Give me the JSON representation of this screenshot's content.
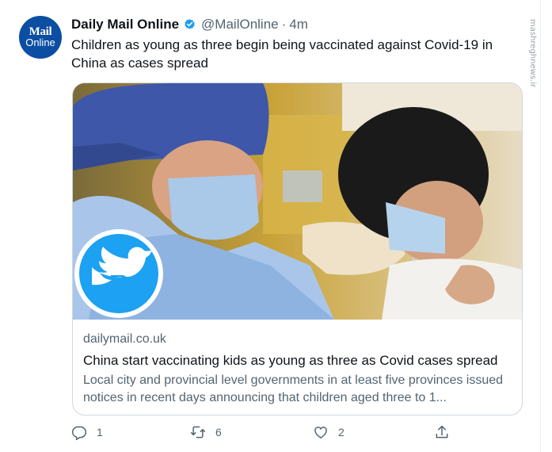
{
  "avatar": {
    "line1": "Mail",
    "line2": "Online"
  },
  "author": {
    "name": "Daily Mail Online",
    "handle": "@MailOnline",
    "separator": "·",
    "time": "4m"
  },
  "tweet": {
    "text": "Children as young as three begin being vaccinated against Covid-19 in China as cases spread"
  },
  "card": {
    "domain": "dailymail.co.uk",
    "title": "China start vaccinating kids as young as three as Covid cases spread",
    "description": "Local city and provincial level governments in at least five provinces issued notices in recent days announcing that children aged three to 1..."
  },
  "actions": {
    "replies": "1",
    "retweets": "6",
    "likes": "2"
  },
  "watermark": {
    "text": "mashreghnews.ir"
  },
  "colors": {
    "brand_blue": "#0b4ea2",
    "verified": "#1d9bf0",
    "muted": "#536471",
    "twitter_blue": "#1da1f2"
  },
  "icons": [
    "verified-badge-icon",
    "reply-icon",
    "retweet-icon",
    "like-icon",
    "share-icon",
    "twitter-bird-logo"
  ]
}
